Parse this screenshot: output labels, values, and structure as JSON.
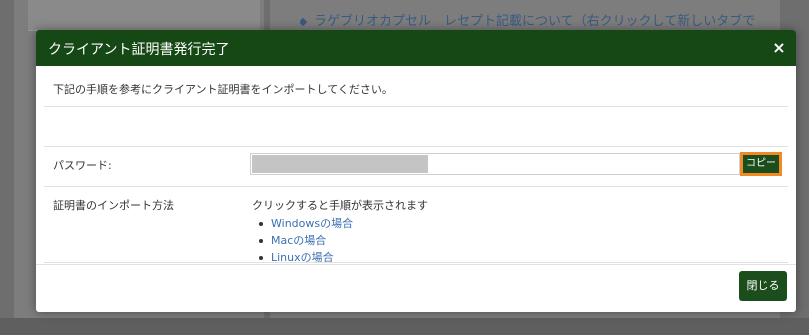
{
  "background": {
    "link_text": "ラゲブリオカプセル　レセプト記載について（右クリックして新しいタブで"
  },
  "modal": {
    "title": "クライアント証明書発行完了",
    "close_symbol": "×",
    "instruction": "下記の手順を参考にクライアント証明書をインポートしてください。",
    "password": {
      "label": "パスワード:",
      "value_masked": true,
      "copy_label": "コピー"
    },
    "import": {
      "label": "証明書のインポート方法",
      "hint": "クリックすると手順が表示されます",
      "items": [
        {
          "label": "Windowsの場合"
        },
        {
          "label": "Macの場合"
        },
        {
          "label": "Linuxの場合"
        }
      ]
    },
    "close_button_label": "閉じる"
  },
  "colors": {
    "header_bg": "#164816",
    "button_bg": "#1c4d1c",
    "copy_highlight": "#f08a24",
    "link": "#3d6fb3"
  }
}
